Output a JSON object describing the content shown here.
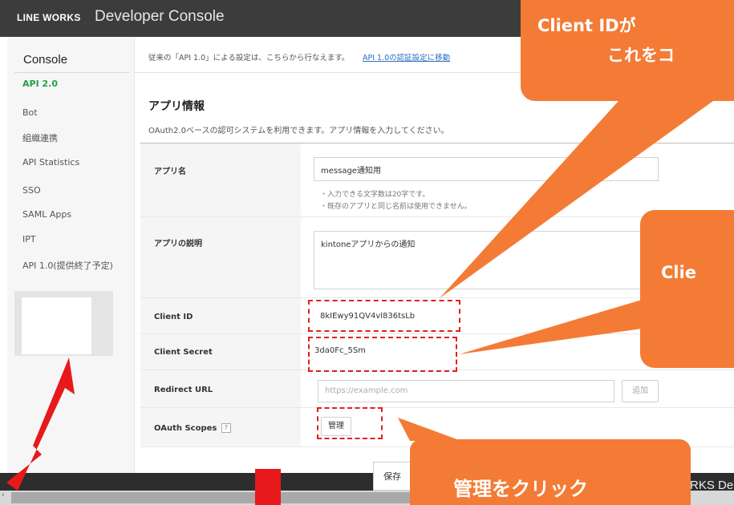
{
  "header": {
    "brand": "LINE WORKS",
    "title": "Developer Console"
  },
  "sidebar": {
    "title": "Console",
    "items": [
      {
        "label": "API 2.0",
        "active": true
      },
      {
        "label": "Bot"
      },
      {
        "label": "組織連携"
      },
      {
        "label": "API Statistics"
      },
      {
        "label": "SSO"
      },
      {
        "label": "SAML Apps"
      },
      {
        "label": "IPT"
      },
      {
        "label": "API 1.0(提供終了予定)"
      }
    ]
  },
  "notice": {
    "text": "従来の「API 1.0」による設定は、こちらから行なえます。",
    "link": "API 1.0の認証設定に移動"
  },
  "main": {
    "section_title": "アプリ情報",
    "section_desc": "OAuth2.0ベースの認可システムを利用できます。アプリ情報を入力してください。",
    "app_name": {
      "label": "アプリ名",
      "value": "message通知用",
      "hints": [
        "・入力できる文字数は20字です。",
        "・既存のアプリと同じ名前は使用できません。"
      ]
    },
    "app_desc": {
      "label": "アプリの説明",
      "value": "kintoneアプリからの通知"
    },
    "client_id": {
      "label": "Client ID",
      "value": "8kIEwy91QV4vl836tsLb"
    },
    "client_secret": {
      "label": "Client Secret",
      "value": "3da0Fc_5Sm"
    },
    "redirect_url": {
      "label": "Redirect URL",
      "placeholder": "https://example.com",
      "add_button": "追加"
    },
    "oauth_scopes": {
      "label": "OAuth Scopes",
      "help": "?",
      "manage_button": "管理"
    },
    "save_button": "保存"
  },
  "annotations": {
    "top_line1": "Client IDが",
    "top_line2": "これをコ",
    "middle": "Clie",
    "bottom": "管理をクリック",
    "accent_color": "#f47b35",
    "highlight_color": "#e0201e",
    "arrow_color": "#e8191b"
  },
  "footer": {
    "logo_fragment": "RKS De"
  }
}
